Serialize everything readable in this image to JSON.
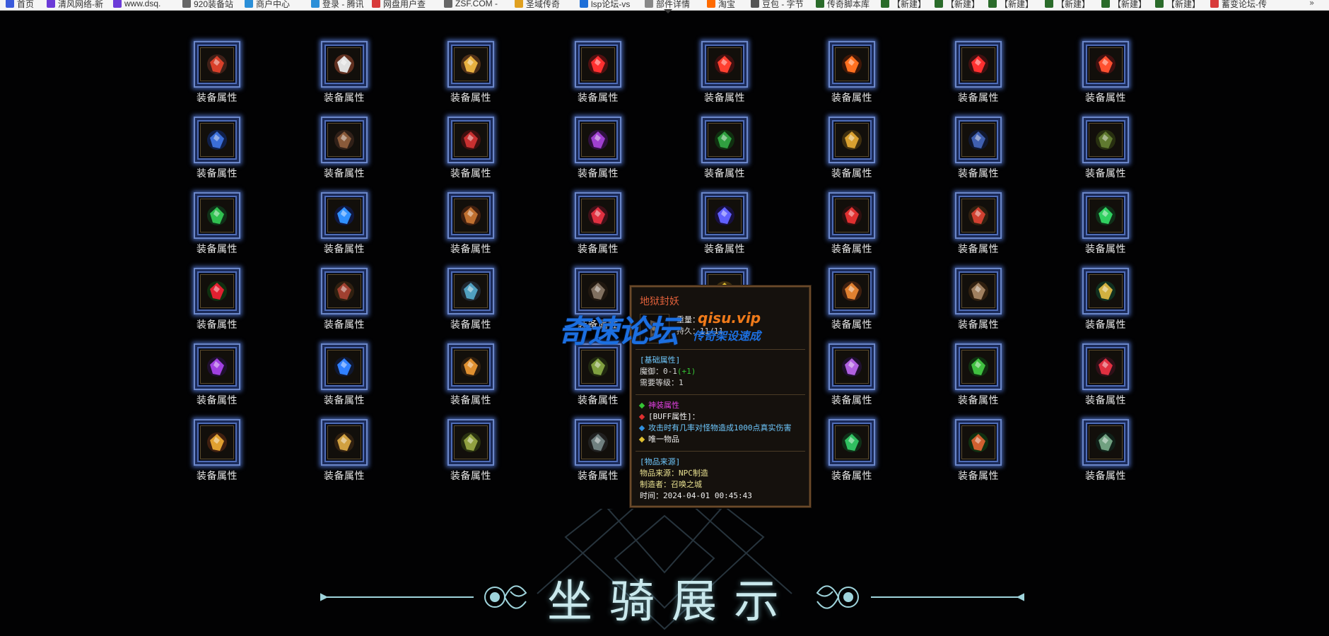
{
  "bookmarks": [
    {
      "label": "首页",
      "color": "#3b5bdb"
    },
    {
      "label": "清风网络-新",
      "color": "#6c3bd8"
    },
    {
      "label": "www.dsq.",
      "color": "#6c3bd8"
    },
    {
      "label": "920装备站",
      "color": "#666"
    },
    {
      "label": "商户中心",
      "color": "#2b8fd8"
    },
    {
      "label": "登录 - 腾讯",
      "color": "#2b8fd8"
    },
    {
      "label": "网盘用户查",
      "color": "#d83b3b"
    },
    {
      "label": "ZSF.COM -",
      "color": "#666"
    },
    {
      "label": "圣域传奇",
      "color": "#e0a020"
    },
    {
      "label": "lsp论坛-vs",
      "color": "#1e6fd8"
    },
    {
      "label": "部件详情",
      "color": "#888"
    },
    {
      "label": "淘宝",
      "color": "#ff6a00"
    },
    {
      "label": "豆包 - 字节",
      "color": "#555"
    },
    {
      "label": "传奇脚本库",
      "color": "#2a6b2a"
    },
    {
      "label": "【新建】",
      "color": "#2a6b2a"
    },
    {
      "label": "【新建】",
      "color": "#2a6b2a"
    },
    {
      "label": "【新建】",
      "color": "#2a6b2a"
    },
    {
      "label": "【新建】",
      "color": "#2a6b2a"
    },
    {
      "label": "【新建】",
      "color": "#2a6b2a"
    },
    {
      "label": "【新建】",
      "color": "#2a6b2a"
    },
    {
      "label": "蓄变论坛-传",
      "color": "#d83b3b"
    }
  ],
  "grid": {
    "label": "装备属性",
    "rows": [
      [
        {
          "icon": "red-staff-icon",
          "c1": "#d8402a",
          "c2": "#402018"
        },
        {
          "icon": "white-glove-icon",
          "c1": "#e0e0e0",
          "c2": "#603020"
        },
        {
          "icon": "golden-wings-icon",
          "c1": "#e8b040",
          "c2": "#503018"
        },
        {
          "icon": "red-heart-icon",
          "c1": "#ff3030",
          "c2": "#501010"
        },
        {
          "icon": "red-flame-icon",
          "c1": "#ff4030",
          "c2": "#401010"
        },
        {
          "icon": "fire-ring-icon",
          "c1": "#ff7020",
          "c2": "#401808"
        },
        {
          "icon": "twin-flame-icon",
          "c1": "#ff3030",
          "c2": "#401010"
        },
        {
          "icon": "fire-burst-icon",
          "c1": "#ff5030",
          "c2": "#401010"
        }
      ],
      [
        {
          "icon": "blue-book-icon",
          "c1": "#3b6ed8",
          "c2": "#10204a"
        },
        {
          "icon": "brown-book-icon",
          "c1": "#8a5a3a",
          "c2": "#302018"
        },
        {
          "icon": "red-book-icon",
          "c1": "#c83030",
          "c2": "#401010"
        },
        {
          "icon": "purple-book-icon",
          "c1": "#a040d0",
          "c2": "#301040"
        },
        {
          "icon": "green-book-icon",
          "c1": "#30a040",
          "c2": "#103010"
        },
        {
          "icon": "gold-book-icon",
          "c1": "#d8a030",
          "c2": "#403010"
        },
        {
          "icon": "navy-book-icon",
          "c1": "#4060b0",
          "c2": "#101830"
        },
        {
          "icon": "olive-book-icon",
          "c1": "#607a30",
          "c2": "#283010"
        }
      ],
      [
        {
          "icon": "green-crystal-icon",
          "c1": "#30c050",
          "c2": "#103018"
        },
        {
          "icon": "blue-crystal-icon",
          "c1": "#3090ff",
          "c2": "#101840"
        },
        {
          "icon": "bronze-armor-icon",
          "c1": "#c07030",
          "c2": "#402010"
        },
        {
          "icon": "red-gem-icon",
          "c1": "#e03040",
          "c2": "#401018"
        },
        {
          "icon": "blue-orb-icon",
          "c1": "#6060ff",
          "c2": "#181040"
        },
        {
          "icon": "red-shard-icon",
          "c1": "#e03030",
          "c2": "#301010"
        },
        {
          "icon": "bagua-icon",
          "c1": "#d04030",
          "c2": "#302010"
        },
        {
          "icon": "jade-stone-icon",
          "c1": "#30d060",
          "c2": "#103018"
        }
      ],
      [
        {
          "icon": "red-rose-icon",
          "c1": "#e02030",
          "c2": "#103010"
        },
        {
          "icon": "old-tome-icon",
          "c1": "#a04030",
          "c2": "#302010"
        },
        {
          "icon": "teal-helmet-icon",
          "c1": "#50a0c0",
          "c2": "#202830"
        },
        {
          "icon": "dark-scroll-icon",
          "c1": "#807060",
          "c2": "#201810"
        },
        {
          "icon": "gold-nugget-icon",
          "c1": "#e0c030",
          "c2": "#403010"
        },
        {
          "icon": "pumpkin-icon",
          "c1": "#e08030",
          "c2": "#402010"
        },
        {
          "icon": "wooden-bow-icon",
          "c1": "#a08060",
          "c2": "#302010"
        },
        {
          "icon": "gold-emblem-icon",
          "c1": "#d0b040",
          "c2": "#103020"
        }
      ],
      [
        {
          "icon": "purple-orb-icon",
          "c1": "#a040e0",
          "c2": "#201030"
        },
        {
          "icon": "blue-flame-icon",
          "c1": "#3080ff",
          "c2": "#101830"
        },
        {
          "icon": "amber-shield-icon",
          "c1": "#e09030",
          "c2": "#302010"
        },
        {
          "icon": "serpent-ring-icon",
          "c1": "#80a040",
          "c2": "#202810"
        },
        {
          "icon": "silver-bead-icon",
          "c1": "#b0b0d0",
          "c2": "#201830"
        },
        {
          "icon": "purple-pendant-icon",
          "c1": "#b060e0",
          "c2": "#201030"
        },
        {
          "icon": "emerald-ring-icon",
          "c1": "#40c040",
          "c2": "#103010"
        },
        {
          "icon": "ruby-cluster-icon",
          "c1": "#e03040",
          "c2": "#301018"
        }
      ],
      [
        {
          "icon": "golden-dragon-icon",
          "c1": "#e0a030",
          "c2": "#402010"
        },
        {
          "icon": "golden-beast-icon",
          "c1": "#d0a040",
          "c2": "#302010"
        },
        {
          "icon": "turtle-shell-icon",
          "c1": "#90a040",
          "c2": "#283010"
        },
        {
          "icon": "stone-box-icon",
          "c1": "#708080",
          "c2": "#202020"
        },
        {
          "icon": "gold-nugget-icon",
          "c1": "#e0c030",
          "c2": "#403010"
        },
        {
          "icon": "green-wing-icon",
          "c1": "#30c060",
          "c2": "#103018"
        },
        {
          "icon": "jungle-flower-icon",
          "c1": "#d06030",
          "c2": "#103010"
        },
        {
          "icon": "jade-hook-icon",
          "c1": "#70a080",
          "c2": "#102018"
        }
      ]
    ]
  },
  "tooltip": {
    "name": "地狱封妖",
    "type_line": "重量：",
    "durability_line": "持久：11/11",
    "base_header": "[基础属性]",
    "magic_def": "魔御：0-1",
    "magic_def_bonus": "(+1)",
    "req_level": "需要等级：1",
    "attr1": "神装属性",
    "attr2": "[BUFF属性]：",
    "attr3": "攻击时有几率对怪物造成1000点真实伤害",
    "attr4": "唯一物品",
    "source_header": "[物品来源]",
    "source": "物品来源：NPC制造",
    "maker": "制造者：召唤之城",
    "time": "时间：2024-04-01 00:45:43"
  },
  "watermark": {
    "main": "奇速论坛",
    "url": "qisu.vip",
    "tagline": "传奇架设速成"
  },
  "banner": {
    "title": "坐骑展示"
  }
}
